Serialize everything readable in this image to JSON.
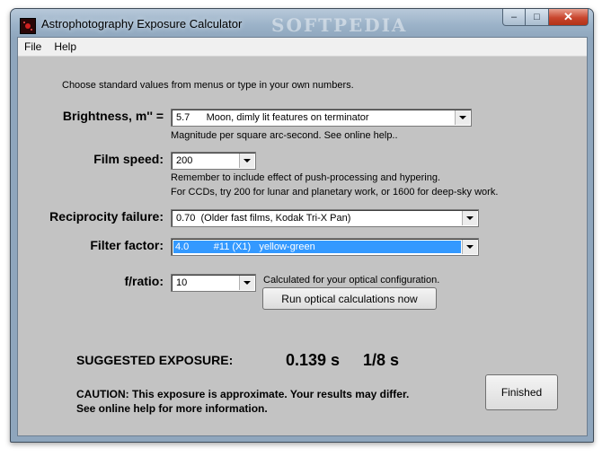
{
  "window": {
    "title": "Astrophotography Exposure Calculator",
    "watermark": "SOFTPEDIA",
    "controls": {
      "minimize": "–",
      "maximize": "□",
      "close": "✕"
    }
  },
  "menu": [
    "File",
    "Help"
  ],
  "instruction": "Choose standard values from menus or type in your own numbers.",
  "brightness": {
    "label": "Brightness, m'' =",
    "value": "5.7      Moon, dimly lit features on terminator",
    "hint": "Magnitude per square arc-second.  See online help.."
  },
  "film_speed": {
    "label": "Film speed:",
    "value": "200",
    "hint1": "Remember to include effect of  push-processing and hypering.",
    "hint2": "For CCDs, try 200 for lunar and planetary work, or 1600 for deep-sky work."
  },
  "reciprocity": {
    "label": "Reciprocity failure:",
    "value": "0.70  (Older fast films, Kodak Tri-X Pan)"
  },
  "filter": {
    "label": "Filter factor:",
    "value": "4.0         #11 (X1)   yellow-green"
  },
  "fratio": {
    "label": "f/ratio:",
    "value": "10",
    "hint": "Calculated for your optical configuration.",
    "button": "Run optical calculations now"
  },
  "exposure": {
    "label": "SUGGESTED EXPOSURE:",
    "seconds": "0.139 s",
    "fraction": "1/8 s"
  },
  "caution": {
    "line1": "CAUTION:  This exposure is approximate.  Your results may differ.",
    "line2": "See online help for more information."
  },
  "finished_button": "Finished",
  "colors": {
    "client_bg": "#c3c3c3",
    "selection": "#3399ff",
    "title_bar": "#9bb2c8",
    "close_button": "#c8452d"
  }
}
